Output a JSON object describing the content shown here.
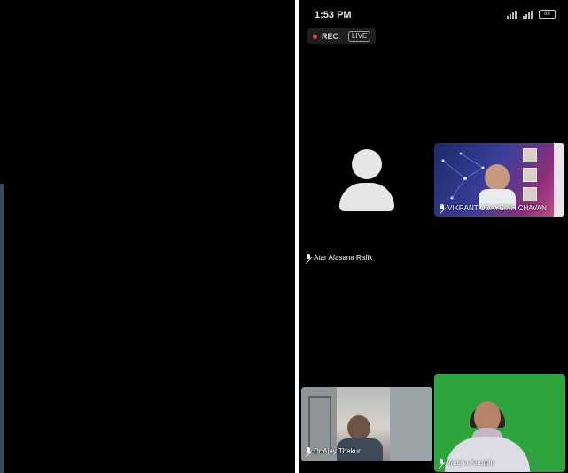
{
  "status_bar": {
    "time": "1:53 PM",
    "battery": "88"
  },
  "recording": {
    "rec_label": "REC",
    "live_label": "LIVE"
  },
  "participants": {
    "main": {
      "name": "Atar Afasana Rafik"
    },
    "vikrant": {
      "name": "VIKRANT UDAYSINH CHAVAN"
    },
    "ajay": {
      "name": "Dr Ajay Thakur"
    },
    "varsha": {
      "name": "Varsha Kamble"
    }
  },
  "icons": {
    "avatar": "default-user-avatar-icon",
    "mic": "microphone-muted-icon",
    "signal": "signal-bars-icon",
    "battery": "battery-icon"
  },
  "colors": {
    "rec_dot": "#e0393e",
    "background": "#000000",
    "green_screen": "#2fa33d"
  }
}
